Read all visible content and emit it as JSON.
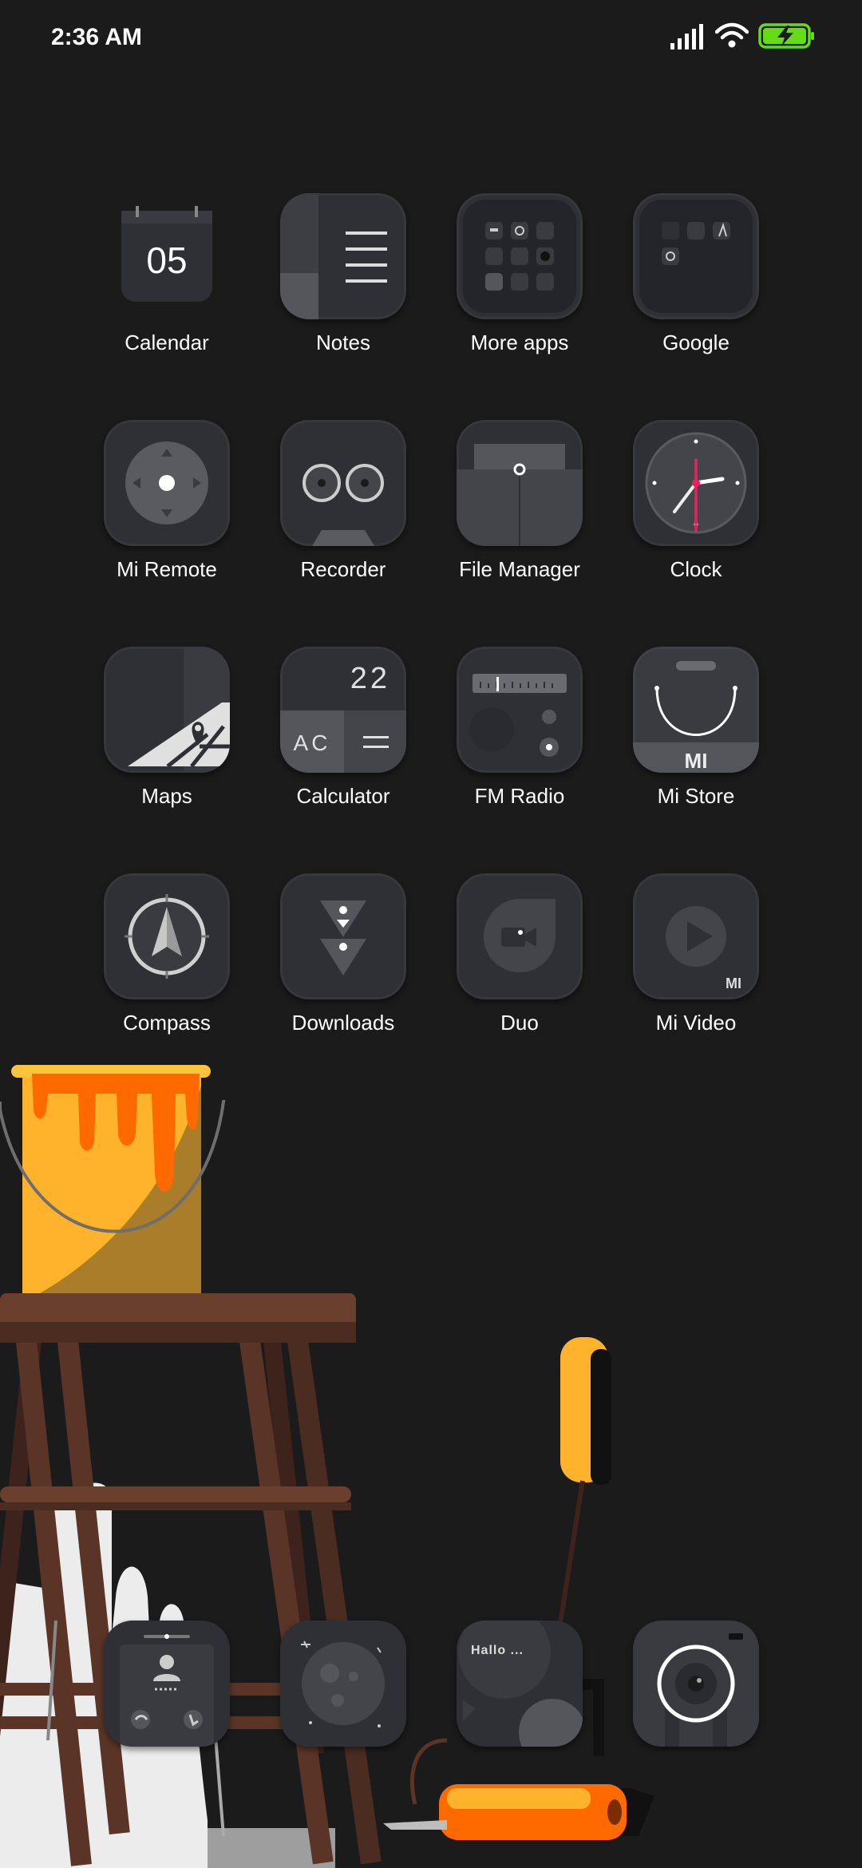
{
  "status_bar": {
    "time": "2:36 AM",
    "icons": [
      "signal-icon",
      "wifi-icon",
      "battery-charging-icon"
    ],
    "battery_color": "#64dd17"
  },
  "home": {
    "apps": [
      {
        "name": "calendar",
        "label": "Calendar",
        "icon_text": "05"
      },
      {
        "name": "notes",
        "label": "Notes"
      },
      {
        "name": "more-apps",
        "label": "More apps"
      },
      {
        "name": "google",
        "label": "Google"
      },
      {
        "name": "mi-remote",
        "label": "Mi Remote"
      },
      {
        "name": "recorder",
        "label": "Recorder"
      },
      {
        "name": "file-manager",
        "label": "File Manager"
      },
      {
        "name": "clock",
        "label": "Clock"
      },
      {
        "name": "maps",
        "label": "Maps"
      },
      {
        "name": "calculator",
        "label": "Calculator",
        "icon_text": "22",
        "icon_text2": "AC"
      },
      {
        "name": "fm-radio",
        "label": "FM Radio"
      },
      {
        "name": "mi-store",
        "label": "Mi Store",
        "icon_text": "MI"
      },
      {
        "name": "compass",
        "label": "Compass"
      },
      {
        "name": "downloads",
        "label": "Downloads"
      },
      {
        "name": "duo",
        "label": "Duo"
      },
      {
        "name": "mi-video",
        "label": "Mi Video",
        "icon_text": "MI"
      }
    ]
  },
  "dock": {
    "apps": [
      {
        "name": "phone",
        "icon": "phone-icon"
      },
      {
        "name": "browser",
        "icon": "planet-icon"
      },
      {
        "name": "messaging",
        "icon": "chat-bubble-icon",
        "icon_text": "Hallo ..."
      },
      {
        "name": "camera",
        "icon": "camera-icon"
      }
    ]
  },
  "colors": {
    "background": "#1b1b1b",
    "icon_bg": "#2f3035",
    "icon_light": "#4a4b50",
    "accent_red": "#e91e63",
    "paint_yellow": "#ffb22c",
    "paint_orange": "#ff6a00",
    "wood": "#5a3527"
  }
}
